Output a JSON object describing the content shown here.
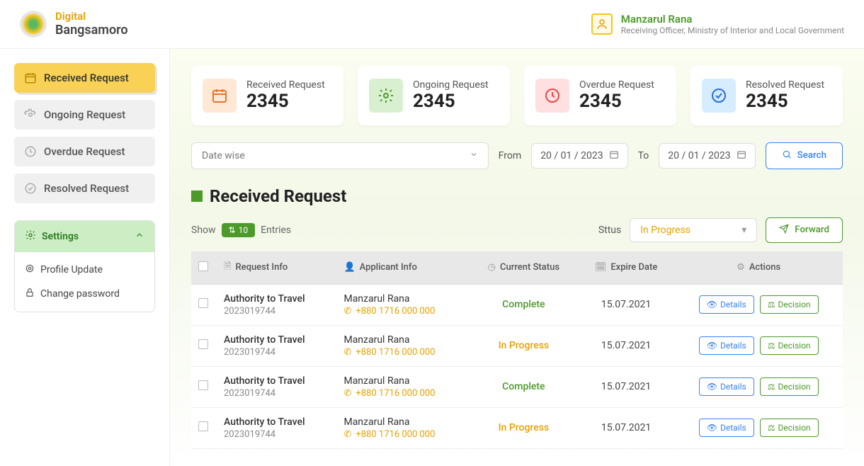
{
  "brand": {
    "line1": "Digital",
    "line2": "Bangsamoro"
  },
  "user": {
    "name": "Manzarul Rana",
    "role": "Receiving Officer, Ministry of Interior and Local Government"
  },
  "nav": {
    "items": [
      {
        "label": "Received Request"
      },
      {
        "label": "Ongoing Request"
      },
      {
        "label": "Overdue Request"
      },
      {
        "label": "Resolved Request"
      }
    ]
  },
  "settings": {
    "title": "Settings",
    "items": [
      {
        "label": "Profile Update"
      },
      {
        "label": "Change password"
      }
    ]
  },
  "cards": [
    {
      "label": "Received Request",
      "value": "2345"
    },
    {
      "label": "Ongoing Request",
      "value": "2345"
    },
    {
      "label": "Overdue Request",
      "value": "2345"
    },
    {
      "label": "Resolved Request",
      "value": "2345"
    }
  ],
  "filter": {
    "datewise": "Date wise",
    "from_label": "From",
    "date_from": "20 / 01 / 2023",
    "to_label": "To",
    "date_to": "20 / 01 / 2023",
    "search_label": "Search"
  },
  "page_heading": "Received Request",
  "table_ctrl": {
    "show": "Show",
    "entries_count": "10",
    "entries_label": "Entries",
    "status_label": "Sttus",
    "status_value": "In Progress",
    "forward_label": "Forward"
  },
  "table": {
    "headers": {
      "request": "Request Info",
      "applicant": "Applicant Info",
      "status": "Current Status",
      "expire": "Expire Date",
      "actions": "Actions"
    },
    "action_labels": {
      "details": "Details",
      "decision": "Decision"
    },
    "rows": [
      {
        "title": "Authority to Travel",
        "id": "2023019744",
        "name": "Manzarul Rana",
        "phone": "+880 1716 000 000",
        "status": "Complete",
        "expire": "15.07.2021"
      },
      {
        "title": "Authority to Travel",
        "id": "2023019744",
        "name": "Manzarul Rana",
        "phone": "+880 1716 000 000",
        "status": "In Progress",
        "expire": "15.07.2021"
      },
      {
        "title": "Authority to Travel",
        "id": "2023019744",
        "name": "Manzarul Rana",
        "phone": "+880 1716 000 000",
        "status": "Complete",
        "expire": "15.07.2021"
      },
      {
        "title": "Authority to Travel",
        "id": "2023019744",
        "name": "Manzarul Rana",
        "phone": "+880 1716 000 000",
        "status": "In Progress",
        "expire": "15.07.2021"
      }
    ]
  }
}
